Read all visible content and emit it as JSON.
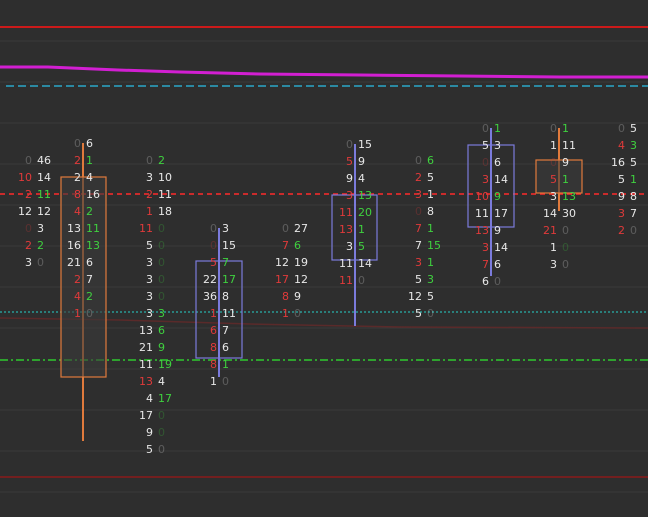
{
  "theme": {
    "background": "#2e2e2e",
    "grid": "#3a3a3a",
    "bid_color": "#e8e8e8",
    "ask_color_up": "#3fd13f",
    "bid_color_down": "#e03a3a",
    "up_candle": "#7b7bdc",
    "down_candle": "#e07a3c",
    "upper_red_line": "#cc1a1a",
    "magenta_line": "#d21fd2",
    "cyan_dashed": "#2aa7c9",
    "red_dashed": "#ff2a2a",
    "cyan_dotted": "#26d0c8",
    "green_dashdot": "#2ec92e",
    "lower_red_line": "#8a1a1a"
  },
  "chart_data": {
    "type": "footprint",
    "columns": [
      {
        "candle": "down",
        "cells": [
          [
            "0",
            "46"
          ],
          [
            "10",
            "14"
          ],
          [
            "2",
            "11"
          ],
          [
            "12",
            "12"
          ],
          [
            "0",
            "3"
          ],
          [
            "2",
            "2"
          ],
          [
            "3",
            "0"
          ]
        ],
        "bid_down": [
          false,
          true,
          true,
          false,
          true,
          true,
          false
        ],
        "ask_up": [
          false,
          false,
          true,
          false,
          false,
          true,
          false
        ]
      },
      {
        "candle": "down",
        "cells": [
          [
            "0",
            "6"
          ],
          [
            "2",
            "1"
          ],
          [
            "2",
            "4"
          ],
          [
            "8",
            "16"
          ],
          [
            "4",
            "2"
          ],
          [
            "13",
            "11"
          ],
          [
            "16",
            "13"
          ],
          [
            "21",
            "6"
          ],
          [
            "2",
            "7"
          ],
          [
            "4",
            "2"
          ],
          [
            "1",
            "0"
          ]
        ],
        "bid_down": [
          false,
          true,
          false,
          true,
          true,
          false,
          false,
          false,
          true,
          true,
          true
        ],
        "ask_up": [
          false,
          true,
          false,
          false,
          true,
          true,
          true,
          false,
          false,
          true,
          false
        ]
      },
      {
        "candle": "none",
        "cells": [
          [
            "0",
            "2"
          ],
          [
            "3",
            "10"
          ],
          [
            "2",
            "11"
          ],
          [
            "1",
            "18"
          ],
          [
            "11",
            "0"
          ],
          [
            "5",
            "0"
          ],
          [
            "3",
            "0"
          ],
          [
            "3",
            "0"
          ],
          [
            "3",
            "0"
          ],
          [
            "3",
            "3"
          ],
          [
            "13",
            "6"
          ],
          [
            "21",
            "9"
          ],
          [
            "11",
            "19"
          ],
          [
            "13",
            "4"
          ],
          [
            "4",
            "17"
          ],
          [
            "17",
            "0"
          ],
          [
            "9",
            "0"
          ],
          [
            "5",
            "0"
          ]
        ],
        "bid_down": [
          false,
          false,
          true,
          true,
          true,
          false,
          false,
          false,
          false,
          false,
          false,
          false,
          false,
          true,
          false,
          false,
          false,
          false
        ],
        "ask_up": [
          true,
          false,
          false,
          false,
          true,
          true,
          true,
          true,
          true,
          true,
          true,
          true,
          true,
          false,
          true,
          true,
          true,
          false
        ]
      },
      {
        "candle": "up",
        "cells": [
          [
            "0",
            "3"
          ],
          [
            "0",
            "15"
          ],
          [
            "5",
            "7"
          ],
          [
            "22",
            "17"
          ],
          [
            "36",
            "8"
          ],
          [
            "1",
            "11"
          ],
          [
            "6",
            "7"
          ],
          [
            "8",
            "6"
          ],
          [
            "8",
            "1"
          ],
          [
            "1",
            "0"
          ]
        ],
        "bid_down": [
          false,
          true,
          true,
          false,
          false,
          true,
          true,
          true,
          true,
          false
        ],
        "ask_up": [
          false,
          false,
          true,
          true,
          false,
          false,
          false,
          false,
          true,
          false
        ]
      },
      {
        "candle": "none",
        "cells": [
          [
            "0",
            "27"
          ],
          [
            "7",
            "6"
          ],
          [
            "12",
            "19"
          ],
          [
            "17",
            "12"
          ],
          [
            "8",
            "9"
          ],
          [
            "1",
            "0"
          ]
        ],
        "bid_down": [
          false,
          true,
          false,
          true,
          true,
          true
        ],
        "ask_up": [
          false,
          true,
          false,
          false,
          false,
          false
        ]
      },
      {
        "candle": "up",
        "cells": [
          [
            "0",
            "15"
          ],
          [
            "5",
            "9"
          ],
          [
            "9",
            "4"
          ],
          [
            "3",
            "13"
          ],
          [
            "11",
            "20"
          ],
          [
            "13",
            "1"
          ],
          [
            "3",
            "5"
          ],
          [
            "11",
            "14"
          ],
          [
            "11",
            "0"
          ]
        ],
        "bid_down": [
          false,
          true,
          false,
          true,
          true,
          true,
          false,
          false,
          true
        ],
        "ask_up": [
          false,
          false,
          false,
          true,
          true,
          true,
          true,
          false,
          false
        ]
      },
      {
        "candle": "none",
        "cells": [
          [
            "0",
            "6"
          ],
          [
            "2",
            "5"
          ],
          [
            "3",
            "1"
          ],
          [
            "0",
            "8"
          ],
          [
            "7",
            "1"
          ],
          [
            "7",
            "15"
          ],
          [
            "3",
            "1"
          ],
          [
            "5",
            "3"
          ],
          [
            "12",
            "5"
          ],
          [
            "5",
            "0"
          ]
        ],
        "bid_down": [
          false,
          true,
          true,
          true,
          true,
          false,
          true,
          false,
          false,
          false
        ],
        "ask_up": [
          true,
          false,
          false,
          false,
          true,
          true,
          true,
          true,
          false,
          false
        ]
      },
      {
        "candle": "up",
        "cells": [
          [
            "0",
            "1"
          ],
          [
            "5",
            "3"
          ],
          [
            "0",
            "6"
          ],
          [
            "3",
            "14"
          ],
          [
            "10",
            "9"
          ],
          [
            "11",
            "17"
          ],
          [
            "13",
            "9"
          ],
          [
            "3",
            "14"
          ],
          [
            "7",
            "6"
          ],
          [
            "6",
            "0"
          ]
        ],
        "bid_down": [
          false,
          false,
          true,
          true,
          true,
          false,
          true,
          true,
          true,
          false
        ],
        "ask_up": [
          true,
          false,
          false,
          false,
          true,
          false,
          false,
          false,
          false,
          false
        ]
      },
      {
        "candle": "down",
        "cells": [
          [
            "0",
            "1"
          ],
          [
            "1",
            "11"
          ],
          [
            "0",
            "9"
          ],
          [
            "5",
            "1"
          ],
          [
            "3",
            "13"
          ],
          [
            "14",
            "30"
          ],
          [
            "21",
            "0"
          ],
          [
            "1",
            "0"
          ],
          [
            "3",
            "0"
          ]
        ],
        "bid_down": [
          false,
          false,
          true,
          true,
          false,
          false,
          true,
          false,
          false
        ],
        "ask_up": [
          true,
          false,
          false,
          true,
          true,
          false,
          false,
          true,
          false
        ]
      },
      {
        "candle": "none",
        "cells": [
          [
            "0",
            "5"
          ],
          [
            "4",
            "3"
          ],
          [
            "16",
            "5"
          ],
          [
            "5",
            "1"
          ],
          [
            "9",
            "8"
          ],
          [
            "3",
            "7"
          ],
          [
            "2",
            "0"
          ]
        ],
        "bid_down": [
          false,
          true,
          false,
          false,
          false,
          true,
          true
        ],
        "ask_up": [
          false,
          true,
          false,
          true,
          false,
          false,
          false
        ]
      }
    ]
  }
}
